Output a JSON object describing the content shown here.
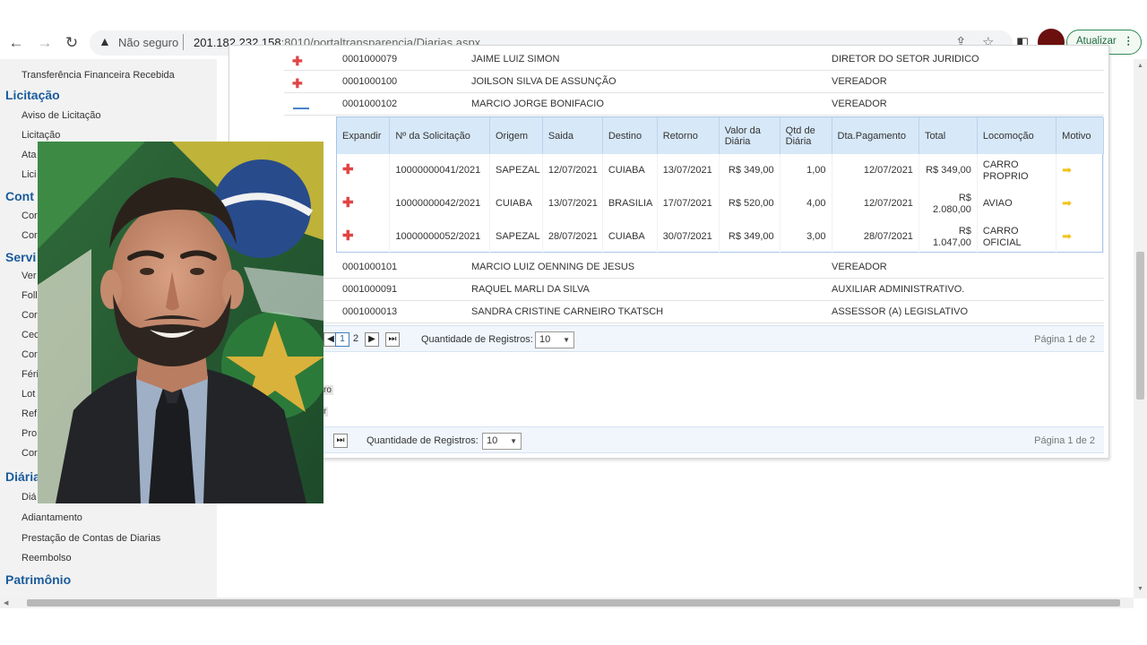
{
  "browser": {
    "security_label": "Não seguro",
    "url_host": "201.182.232.158",
    "url_path": ":8010/portaltransparencia/Diarias.aspx",
    "update_label": "Atualizar"
  },
  "sidebar": {
    "items": [
      {
        "type": "item",
        "label": "Transferência Financeira Recebida"
      },
      {
        "type": "section",
        "label": "Licitação"
      },
      {
        "type": "item",
        "label": "Aviso de Licitação"
      },
      {
        "type": "item",
        "label": "Licitação"
      },
      {
        "type": "item",
        "label": "Ata"
      },
      {
        "type": "item",
        "label": "Lici"
      },
      {
        "type": "section",
        "label": "Cont"
      },
      {
        "type": "item",
        "label": "Cor"
      },
      {
        "type": "item",
        "label": "Cor"
      },
      {
        "type": "section",
        "label": "Servi"
      },
      {
        "type": "item",
        "label": "Ver"
      },
      {
        "type": "item",
        "label": "Foll"
      },
      {
        "type": "item",
        "label": "Cor"
      },
      {
        "type": "item",
        "label": "Cec"
      },
      {
        "type": "item",
        "label": "Cor"
      },
      {
        "type": "item",
        "label": "Féri"
      },
      {
        "type": "item",
        "label": "Lot"
      },
      {
        "type": "item",
        "label": "Ref"
      },
      {
        "type": "item",
        "label": "Pro"
      },
      {
        "type": "item",
        "label": "Cor"
      },
      {
        "type": "section",
        "label": "Diária"
      },
      {
        "type": "item",
        "label": "Diá"
      },
      {
        "type": "item",
        "label": "Adiantamento"
      },
      {
        "type": "item",
        "label": "Prestação de Contas de Diarias"
      },
      {
        "type": "item",
        "label": "Reembolso"
      },
      {
        "type": "section",
        "label": "Patrimônio"
      }
    ]
  },
  "outer_rows_top": [
    {
      "icon": "expand",
      "id": "0001000079",
      "name": "JAIME LUIZ SIMON",
      "role": "DIRETOR DO SETOR JURIDICO"
    },
    {
      "icon": "expand",
      "id": "0001000100",
      "name": "JOILSON SILVA DE ASSUNÇÃO",
      "role": "VEREADOR"
    },
    {
      "icon": "collapse",
      "id": "0001000102",
      "name": "MARCIO JORGE BONIFACIO",
      "role": "VEREADOR"
    }
  ],
  "inner_table": {
    "headers": [
      "Expandir",
      "Nº da Solicitação",
      "Origem",
      "Saida",
      "Destino",
      "Retorno",
      "Valor da Diária",
      "Qtd de Diária",
      "Dta.Pagamento",
      "Total",
      "Locomoção",
      "Motivo"
    ],
    "rows": [
      {
        "solicitacao": "10000000041/2021",
        "origem": "SAPEZAL",
        "saida": "12/07/2021",
        "destino": "CUIABA",
        "retorno": "13/07/2021",
        "valor": "R$ 349,00",
        "qtd": "1,00",
        "pagamento": "12/07/2021",
        "total": "R$ 349,00",
        "locomocao": "CARRO PROPRIO"
      },
      {
        "solicitacao": "10000000042/2021",
        "origem": "CUIABA",
        "saida": "13/07/2021",
        "destino": "BRASILIA",
        "retorno": "17/07/2021",
        "valor": "R$ 520,00",
        "qtd": "4,00",
        "pagamento": "12/07/2021",
        "total": "R$ 2.080,00",
        "locomocao": "AVIAO"
      },
      {
        "solicitacao": "10000000052/2021",
        "origem": "SAPEZAL",
        "saida": "28/07/2021",
        "destino": "CUIABA",
        "retorno": "30/07/2021",
        "valor": "R$ 349,00",
        "qtd": "3,00",
        "pagamento": "28/07/2021",
        "total": "R$ 1.047,00",
        "locomocao": "CARRO OFICIAL"
      }
    ]
  },
  "outer_rows_bottom": [
    {
      "id": "0001000101",
      "name": "MARCIO LUIZ OENNING DE JESUS",
      "role": "VEREADOR"
    },
    {
      "id": "0001000091",
      "name": "RAQUEL MARLI DA SILVA",
      "role": "AUXILIAR ADMINISTRATIVO."
    },
    {
      "id": "0001000013",
      "name": "SANDRA CRISTINE CARNEIRO TKATSCH",
      "role": "ASSESSOR (A) LEGISLATIVO"
    }
  ],
  "pager1": {
    "page1": "1",
    "page2": "2",
    "count_label": "Quantidade de Registros:",
    "count_value": "10",
    "info": "Página 1 de 2"
  },
  "pager2": {
    "count_label": "Quantidade de Registros:",
    "count_value": "10",
    "info": "Página 1 de 2"
  },
  "filter_fragments": [
    "ro",
    "r"
  ]
}
